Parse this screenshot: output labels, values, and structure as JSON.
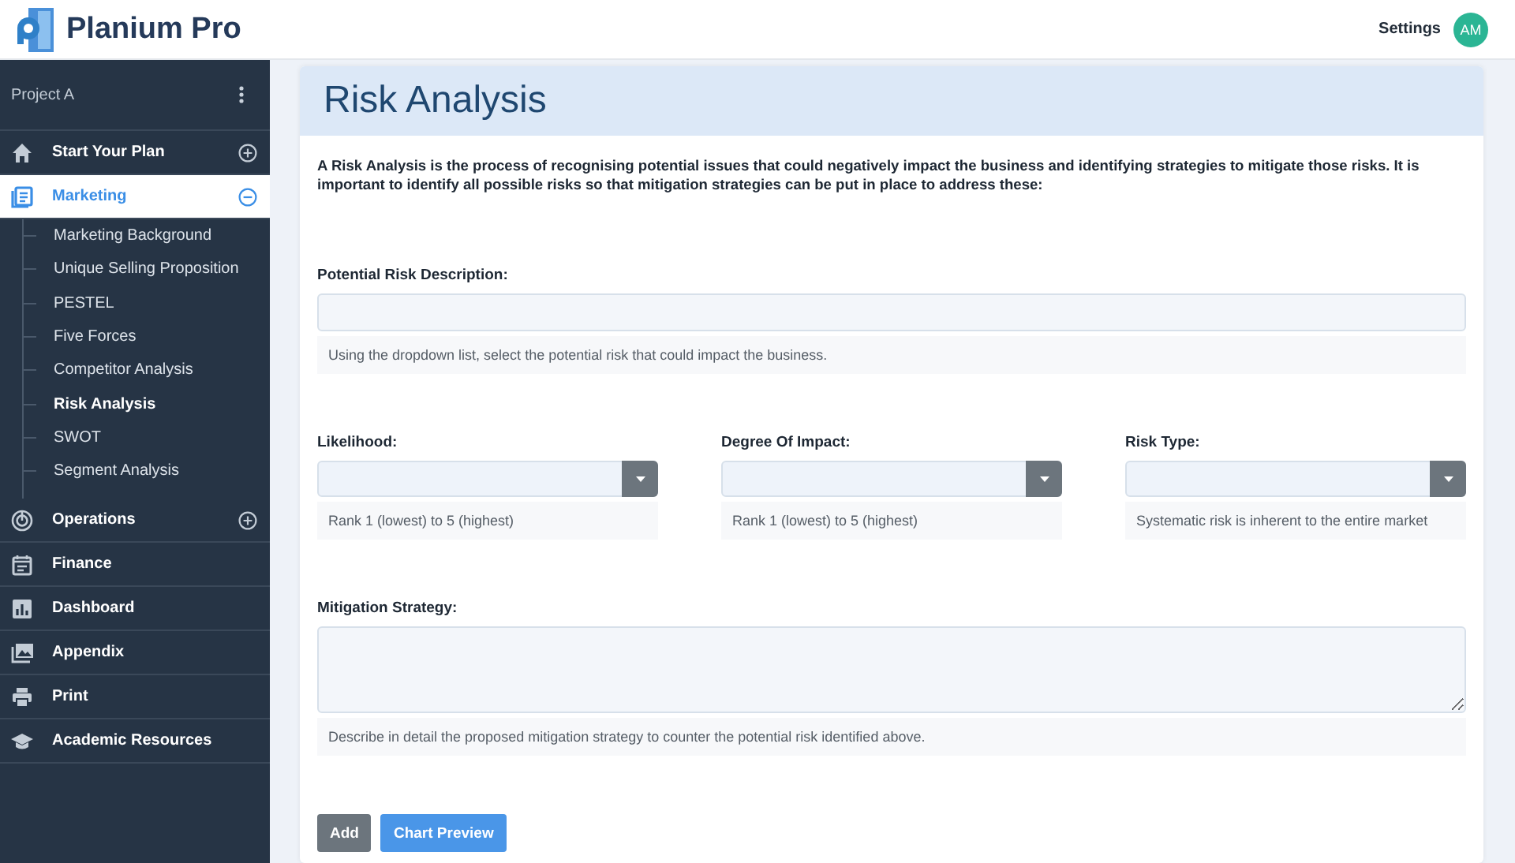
{
  "header": {
    "brand": "Planium Pro",
    "settings": "Settings",
    "avatar": "AM"
  },
  "sidebar": {
    "project": "Project A",
    "nav": [
      {
        "label": "Start Your Plan",
        "selected": false,
        "expanded": false
      },
      {
        "label": "Marketing",
        "selected": true,
        "expanded": true,
        "children": [
          {
            "label": "Marketing Background",
            "selected": false
          },
          {
            "label": "Unique Selling Proposition",
            "selected": false
          },
          {
            "label": "PESTEL",
            "selected": false
          },
          {
            "label": "Five Forces",
            "selected": false
          },
          {
            "label": "Competitor Analysis",
            "selected": false
          },
          {
            "label": "Risk Analysis",
            "selected": true
          },
          {
            "label": "SWOT",
            "selected": false
          },
          {
            "label": "Segment Analysis",
            "selected": false
          }
        ]
      },
      {
        "label": "Operations",
        "selected": false,
        "expanded": false
      },
      {
        "label": "Finance",
        "selected": false
      },
      {
        "label": "Dashboard",
        "selected": false
      },
      {
        "label": "Appendix",
        "selected": false
      },
      {
        "label": "Print",
        "selected": false
      },
      {
        "label": "Academic Resources",
        "selected": false
      }
    ]
  },
  "page": {
    "title": "Risk Analysis",
    "intro": "A Risk Analysis is the process of recognising potential issues that could negatively impact the business and identifying strategies to mitigate those risks. It is important to identify all possible risks so that mitigation strategies can be put in place to address these:",
    "form": [
      {
        "kind": "text",
        "label": "Potential Risk Description:",
        "help": "Using the dropdown list, select the potential risk that could impact the business."
      },
      {
        "kind": "selects",
        "items": [
          {
            "label": "Likelihood:",
            "help": "Rank 1 (lowest) to 5 (highest)"
          },
          {
            "label": "Degree Of Impact:",
            "help": "Rank 1 (lowest) to 5 (highest)"
          },
          {
            "label": "Risk Type:",
            "help": "Systematic risk is inherent to the entire market"
          }
        ]
      },
      {
        "kind": "textarea",
        "label": "Mitigation Strategy:",
        "help": "Describe in detail the proposed mitigation strategy to counter the potential risk identified above."
      }
    ],
    "buttons": [
      {
        "label": "Add",
        "kind": "secondary"
      },
      {
        "label": "Chart Preview",
        "kind": "primary"
      }
    ]
  }
}
